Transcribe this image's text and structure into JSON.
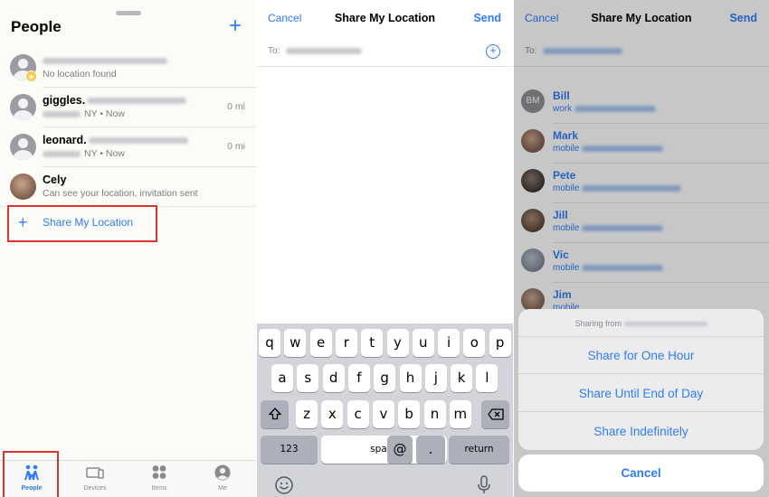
{
  "people_panel": {
    "title": "People",
    "add_icon": "plus-icon",
    "people": [
      {
        "name": "",
        "subtitle": "No location found",
        "distance": "",
        "avatar": "person-silhouette",
        "badge": "star-icon"
      },
      {
        "name": "giggles.",
        "subtitle": "NY • Now",
        "distance": "0 mi",
        "avatar": "person-silhouette"
      },
      {
        "name": "leonard.",
        "subtitle": "NY • Now",
        "distance": "0 mi",
        "avatar": "person-silhouette"
      },
      {
        "name": "Cely",
        "subtitle": "Can see your location, invitation sent",
        "distance": "",
        "avatar": "photo"
      }
    ],
    "share_my_location": "Share My Location",
    "tabs": [
      {
        "label": "People",
        "icon": "people-icon",
        "active": true
      },
      {
        "label": "Devices",
        "icon": "devices-icon",
        "active": false
      },
      {
        "label": "Items",
        "icon": "items-icon",
        "active": false
      },
      {
        "label": "Me",
        "icon": "me-icon",
        "active": false
      }
    ]
  },
  "compose_panel": {
    "cancel": "Cancel",
    "title": "Share My Location",
    "send": "Send",
    "to_label": "To:",
    "keyboard": {
      "row1": [
        "q",
        "w",
        "e",
        "r",
        "t",
        "y",
        "u",
        "i",
        "o",
        "p"
      ],
      "row2": [
        "a",
        "s",
        "d",
        "f",
        "g",
        "h",
        "j",
        "k",
        "l"
      ],
      "row3": [
        "z",
        "x",
        "c",
        "v",
        "b",
        "n",
        "m"
      ],
      "numbers": "123",
      "space": "space",
      "at": "@",
      "dot": ".",
      "return": "return"
    }
  },
  "options_panel": {
    "cancel": "Cancel",
    "title": "Share My Location",
    "send": "Send",
    "to_label": "To:",
    "contacts": [
      {
        "name": "Bill",
        "label": "work",
        "initials": "BM"
      },
      {
        "name": "Mark",
        "label": "mobile",
        "initials": ""
      },
      {
        "name": "Pete",
        "label": "mobile",
        "initials": ""
      },
      {
        "name": "Jill",
        "label": "mobile",
        "initials": ""
      },
      {
        "name": "Vic",
        "label": "mobile",
        "initials": ""
      },
      {
        "name": "Jim",
        "label": "mobile",
        "initials": ""
      }
    ],
    "sheet_title": "Sharing from",
    "options": [
      "Share for One Hour",
      "Share Until End of Day",
      "Share Indefinitely"
    ],
    "sheet_cancel": "Cancel"
  },
  "colors": {
    "accent": "#2f7cf6",
    "highlight_box": "#d9342b"
  }
}
